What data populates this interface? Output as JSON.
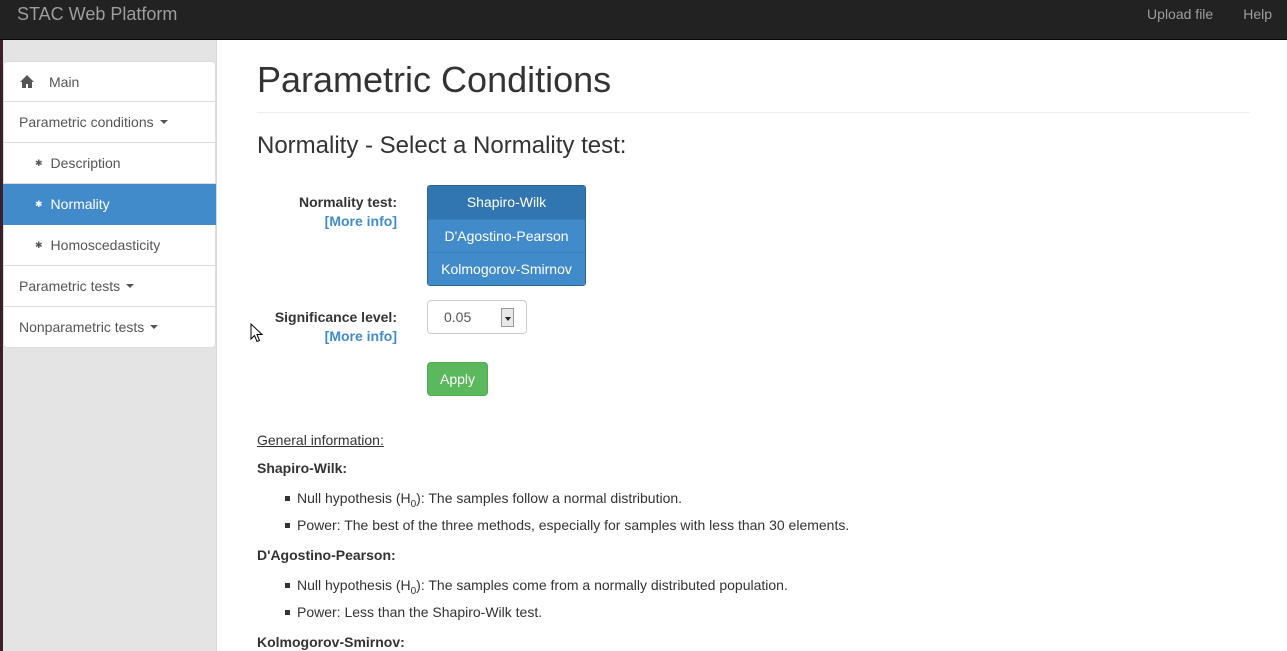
{
  "navbar": {
    "brand": "STAC Web Platform",
    "links": [
      "Upload file",
      "Help"
    ]
  },
  "sidebar": {
    "items": [
      {
        "label": "Main",
        "icon": "home-icon"
      },
      {
        "label": "Parametric conditions"
      },
      {
        "label": "Description"
      },
      {
        "label": "Normality",
        "active": true
      },
      {
        "label": "Homoscedasticity"
      },
      {
        "label": "Parametric tests"
      },
      {
        "label": "Nonparametric tests"
      }
    ]
  },
  "main": {
    "title": "Parametric Conditions",
    "subtitle": "Normality - Select a Normality test:",
    "normality_label": "Normality test:",
    "more_info": "[More info]",
    "tests": [
      "Shapiro-Wilk",
      "D'Agostino-Pearson",
      "Kolmogorov-Smirnov"
    ],
    "selected_test": "Shapiro-Wilk",
    "significance_label": "Significance level:",
    "significance_value": "0.05",
    "apply_label": "Apply"
  },
  "info": {
    "heading": "General information:",
    "sections": [
      {
        "name": "Shapiro-Wilk:",
        "null_prefix": "Null hypothesis (H",
        "null_sub": "0",
        "null_text": "): The samples follow a normal distribution.",
        "power": "Power: The best of the three methods, especially for samples with less than 30 elements."
      },
      {
        "name": "D'Agostino-Pearson:",
        "null_prefix": "Null hypothesis (H",
        "null_sub": "0",
        "null_text": "): The samples come from a normally distributed population.",
        "power": "Power: Less than the Shapiro-Wilk test."
      },
      {
        "name": "Kolmogorov-Smirnov:"
      }
    ]
  },
  "colors": {
    "navbar": "#222222",
    "primary": "#428bca",
    "success": "#5cb85c",
    "sidebar_bg": "#e4e4e4"
  }
}
